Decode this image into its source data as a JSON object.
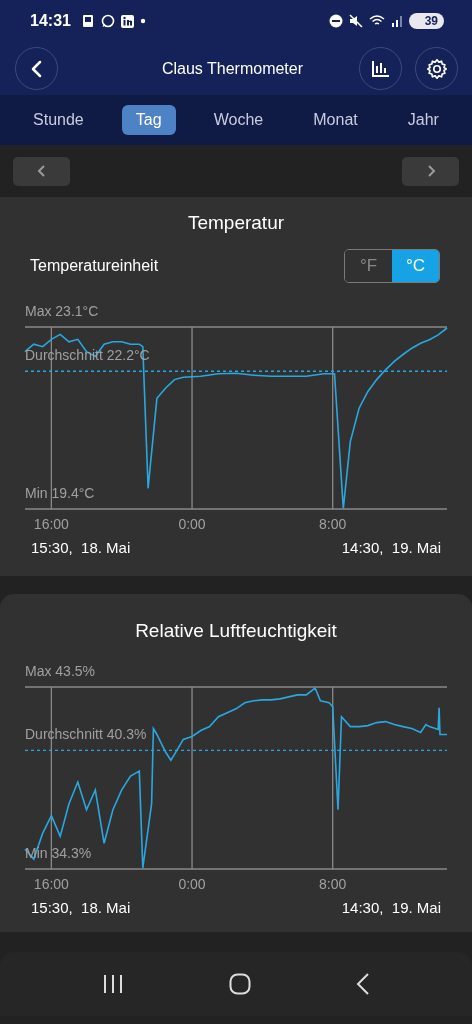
{
  "status_bar": {
    "time": "14:31",
    "battery": "39"
  },
  "header": {
    "title": "Claus Thermometer"
  },
  "tabs": [
    {
      "label": "Stunde",
      "selected": false
    },
    {
      "label": "Tag",
      "selected": true
    },
    {
      "label": "Woche",
      "selected": false
    },
    {
      "label": "Monat",
      "selected": false
    },
    {
      "label": "Jahr",
      "selected": false
    }
  ],
  "cards": [
    {
      "title": "Temperatur",
      "unit_setting": {
        "label": "Temperatureinheit",
        "options": [
          {
            "label": "°F",
            "selected": false
          },
          {
            "label": "°C",
            "selected": true
          }
        ]
      },
      "max_label": "Max 23.1°C",
      "average_label": "Durchschnitt 22.2°C",
      "min_label": "Min 19.4°C",
      "x_labels": [
        "16:00",
        "0:00",
        "8:00"
      ],
      "start_label": "15:30,  18. Mai",
      "end_label": "14:30,  19. Mai"
    },
    {
      "title": "Relative Luftfeuchtigkeit",
      "max_label": "Max 43.5%",
      "average_label": "Durchschnitt 40.3%",
      "min_label": "Min 34.3%",
      "x_labels": [
        "16:00",
        "0:00",
        "8:00"
      ],
      "start_label": "15:30,  18. Mai",
      "end_label": "14:30,  19. Mai"
    }
  ]
}
